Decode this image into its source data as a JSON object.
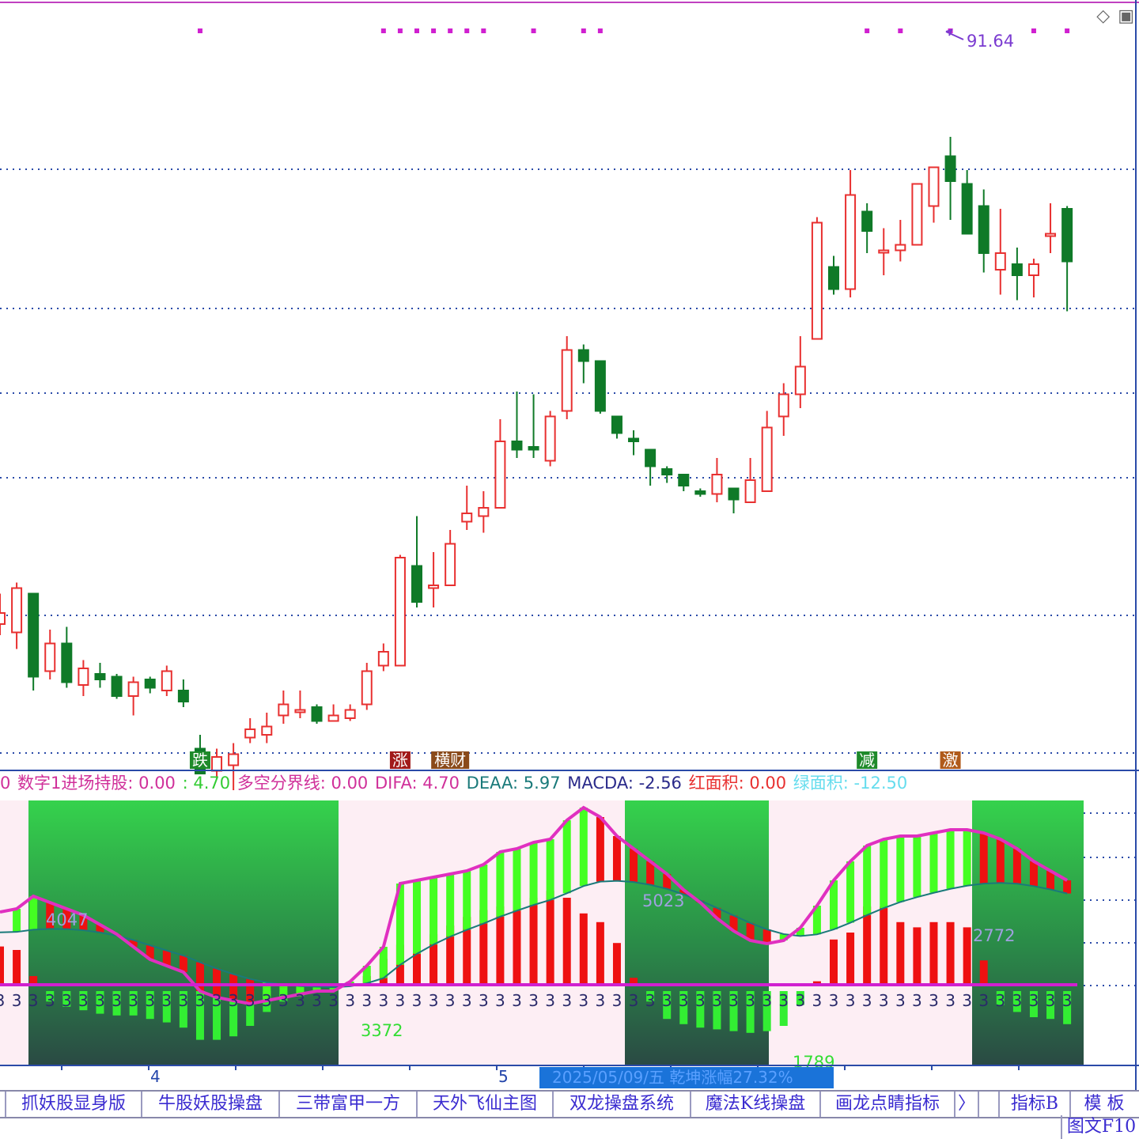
{
  "chart_data": {
    "type": "candlestick",
    "peak_label": "91.64",
    "candles": [
      {
        "o": 76.9,
        "c": 77.3,
        "h": 78.0,
        "l": 76.5
      },
      {
        "o": 76.6,
        "c": 78.2,
        "h": 78.4,
        "l": 76.0
      },
      {
        "o": 78.0,
        "c": 75.0,
        "h": 78.0,
        "l": 74.5
      },
      {
        "o": 75.2,
        "c": 76.2,
        "h": 76.7,
        "l": 74.9
      },
      {
        "o": 76.2,
        "c": 74.8,
        "h": 76.8,
        "l": 74.6
      },
      {
        "o": 74.7,
        "c": 75.3,
        "h": 75.6,
        "l": 74.3
      },
      {
        "o": 75.1,
        "c": 74.9,
        "h": 75.5,
        "l": 74.6
      },
      {
        "o": 75.0,
        "c": 74.3,
        "h": 75.1,
        "l": 74.2
      },
      {
        "o": 74.3,
        "c": 74.8,
        "h": 75.0,
        "l": 73.6
      },
      {
        "o": 74.9,
        "c": 74.6,
        "h": 75.0,
        "l": 74.4
      },
      {
        "o": 74.5,
        "c": 75.2,
        "h": 75.4,
        "l": 74.3
      },
      {
        "o": 74.5,
        "c": 74.1,
        "h": 74.9,
        "l": 73.9
      },
      {
        "o": 72.4,
        "c": 71.5,
        "h": 72.9,
        "l": 71.5
      },
      {
        "o": 71.6,
        "c": 72.1,
        "h": 72.4,
        "l": 71.3
      },
      {
        "o": 71.8,
        "c": 72.2,
        "h": 72.6,
        "l": 70.9
      },
      {
        "o": 72.8,
        "c": 73.1,
        "h": 73.5,
        "l": 72.6
      },
      {
        "o": 72.9,
        "c": 73.2,
        "h": 73.7,
        "l": 72.6
      },
      {
        "o": 73.6,
        "c": 74.0,
        "h": 74.5,
        "l": 73.3
      },
      {
        "o": 73.8,
        "c": 73.8,
        "h": 74.5,
        "l": 73.5
      },
      {
        "o": 73.9,
        "c": 73.4,
        "h": 74.0,
        "l": 73.3
      },
      {
        "o": 73.4,
        "c": 73.6,
        "h": 74.0,
        "l": 73.4
      },
      {
        "o": 73.5,
        "c": 73.8,
        "h": 74.0,
        "l": 73.4
      },
      {
        "o": 74.0,
        "c": 75.2,
        "h": 75.5,
        "l": 73.8
      },
      {
        "o": 75.4,
        "c": 75.9,
        "h": 76.2,
        "l": 75.2
      },
      {
        "o": 75.4,
        "c": 79.3,
        "h": 79.4,
        "l": 75.4
      },
      {
        "o": 79.0,
        "c": 77.7,
        "h": 80.8,
        "l": 77.5
      },
      {
        "o": 78.2,
        "c": 78.3,
        "h": 79.5,
        "l": 77.5
      },
      {
        "o": 78.3,
        "c": 79.8,
        "h": 80.3,
        "l": 78.3
      },
      {
        "o": 80.6,
        "c": 80.9,
        "h": 81.9,
        "l": 80.3
      },
      {
        "o": 80.8,
        "c": 81.1,
        "h": 81.7,
        "l": 80.2
      },
      {
        "o": 81.1,
        "c": 83.5,
        "h": 84.3,
        "l": 81.1
      },
      {
        "o": 83.5,
        "c": 83.2,
        "h": 85.3,
        "l": 82.9
      },
      {
        "o": 83.3,
        "c": 83.2,
        "h": 85.2,
        "l": 82.9
      },
      {
        "o": 82.8,
        "c": 84.4,
        "h": 84.6,
        "l": 82.6
      },
      {
        "o": 84.6,
        "c": 86.8,
        "h": 87.3,
        "l": 84.3
      },
      {
        "o": 86.8,
        "c": 86.4,
        "h": 87.0,
        "l": 85.6
      },
      {
        "o": 86.4,
        "c": 84.6,
        "h": 86.4,
        "l": 84.5
      },
      {
        "o": 84.4,
        "c": 83.8,
        "h": 84.4,
        "l": 83.6
      },
      {
        "o": 83.6,
        "c": 83.5,
        "h": 83.9,
        "l": 83.0
      },
      {
        "o": 83.2,
        "c": 82.6,
        "h": 83.2,
        "l": 81.9
      },
      {
        "o": 82.5,
        "c": 82.3,
        "h": 82.6,
        "l": 82.0
      },
      {
        "o": 82.3,
        "c": 81.9,
        "h": 82.3,
        "l": 81.7
      },
      {
        "o": 81.7,
        "c": 81.6,
        "h": 81.8,
        "l": 81.5
      },
      {
        "o": 81.6,
        "c": 82.3,
        "h": 82.9,
        "l": 81.3
      },
      {
        "o": 81.8,
        "c": 81.4,
        "h": 81.8,
        "l": 80.9
      },
      {
        "o": 81.3,
        "c": 82.1,
        "h": 82.9,
        "l": 81.3
      },
      {
        "o": 81.7,
        "c": 84.0,
        "h": 84.6,
        "l": 81.7
      },
      {
        "o": 84.4,
        "c": 85.2,
        "h": 85.6,
        "l": 83.7
      },
      {
        "o": 85.2,
        "c": 86.2,
        "h": 87.3,
        "l": 84.7
      },
      {
        "o": 87.2,
        "c": 91.4,
        "h": 91.6,
        "l": 87.2
      },
      {
        "o": 89.8,
        "c": 89.0,
        "h": 90.2,
        "l": 88.8
      },
      {
        "o": 89.0,
        "c": 92.4,
        "h": 93.3,
        "l": 88.7
      },
      {
        "o": 91.8,
        "c": 91.1,
        "h": 92.1,
        "l": 90.3
      },
      {
        "o": 90.4,
        "c": 90.4,
        "h": 91.2,
        "l": 89.5
      },
      {
        "o": 90.4,
        "c": 90.6,
        "h": 91.5,
        "l": 90.0
      },
      {
        "o": 90.6,
        "c": 92.8,
        "h": 92.8,
        "l": 90.6
      },
      {
        "o": 92.0,
        "c": 93.4,
        "h": 93.4,
        "l": 91.4
      },
      {
        "o": 93.8,
        "c": 92.9,
        "h": 94.5,
        "l": 91.5
      },
      {
        "o": 92.8,
        "c": 91.0,
        "h": 93.3,
        "l": 91.0
      },
      {
        "o": 92.0,
        "c": 90.3,
        "h": 92.6,
        "l": 89.6
      },
      {
        "o": 89.7,
        "c": 90.3,
        "h": 91.9,
        "l": 88.8
      },
      {
        "o": 89.9,
        "c": 89.5,
        "h": 90.5,
        "l": 88.6
      },
      {
        "o": 89.5,
        "c": 89.9,
        "h": 90.1,
        "l": 88.7
      },
      {
        "o": 91.0,
        "c": 91.0,
        "h": 92.1,
        "l": 90.3
      },
      {
        "o": 91.9,
        "c": 90.0,
        "h": 92.0,
        "l": 88.2
      }
    ],
    "signal_markers": [
      {
        "index": 12,
        "label": "跌",
        "bg": "#1e8a2a"
      },
      {
        "index": 24,
        "label": "涨",
        "bg": "#a11a1a"
      },
      {
        "index": 27,
        "label": "横财",
        "bg": "#8a4a1a"
      },
      {
        "index": 52,
        "label": "减",
        "bg": "#1e8a2a"
      },
      {
        "index": 57,
        "label": "激",
        "bg": "#b05a1a"
      }
    ],
    "macd_values": [
      2.3,
      2.4,
      2.8,
      2.6,
      2.4,
      2.2,
      1.9,
      1.6,
      1.2,
      0.8,
      0.6,
      0.4,
      -0.2,
      -0.4,
      -0.5,
      -0.6,
      -0.5,
      -0.4,
      -0.3,
      -0.2,
      -0.2,
      0.1,
      0.6,
      1.2,
      3.2,
      3.3,
      3.4,
      3.5,
      3.6,
      3.8,
      4.2,
      4.3,
      4.5,
      4.6,
      5.2,
      5.6,
      5.3,
      4.7,
      4.3,
      3.9,
      3.5,
      3.0,
      2.6,
      2.1,
      1.7,
      1.4,
      1.3,
      1.4,
      1.8,
      2.5,
      3.3,
      3.9,
      4.4,
      4.6,
      4.7,
      4.7,
      4.8,
      4.9,
      4.9,
      4.8,
      4.6,
      4.3,
      3.9,
      3.6,
      3.3
    ],
    "histogram": [
      2.2,
      2.0,
      0.5,
      -0.6,
      -0.9,
      -1.1,
      -1.3,
      -1.4,
      -1.4,
      -1.6,
      -1.8,
      -2.1,
      -2.8,
      -2.8,
      -2.6,
      -2.0,
      -1.2,
      -0.6,
      -0.3,
      0,
      0,
      0,
      0.5,
      1.5,
      2.3,
      2.5,
      2.9,
      3.4,
      3.9,
      4.3,
      4.5,
      4.8,
      5.0,
      5.4,
      5.0,
      4.1,
      3.6,
      2.4,
      0.4,
      -0.6,
      -1.6,
      -1.9,
      -2.1,
      -2.2,
      -2.3,
      -2.4,
      -2.3,
      -2.0,
      -0.8,
      0.2,
      2.6,
      3.0,
      4.5,
      4.5,
      3.6,
      3.3,
      3.6,
      3.6,
      3.3,
      1.4,
      -0.8,
      -1.2,
      -1.5,
      -1.6,
      -1.9
    ],
    "value_labels": [
      "4047",
      "3372",
      "5023",
      "1789",
      "2772"
    ],
    "axis_months": [
      "4",
      "5"
    ]
  },
  "indicator": {
    "items": [
      {
        "text": "0",
        "color": "#d0309a"
      },
      {
        "text": "数字1进场持股: 0.00",
        "color": "#d0309a"
      },
      {
        "text": ": 4.70",
        "color": "#33cc33"
      },
      {
        "text": "多空分界线: 0.00",
        "color": "#d0309a"
      },
      {
        "text": "DIFA: 4.70",
        "color": "#d0309a"
      },
      {
        "text": "DEAA: 5.97",
        "color": "#1a7a7a"
      },
      {
        "text": "MACDA: -2.56",
        "color": "#2a2a8a"
      },
      {
        "text": "红面积: 0.00",
        "color": "#e83030"
      },
      {
        "text": "绿面积: -12.50",
        "color": "#66ddee"
      }
    ]
  },
  "status": {
    "date_text": "2025/05/09/五    乾坤涨幅27.32%"
  },
  "tabs": [
    {
      "label": "抓妖股显身版"
    },
    {
      "label": "牛股妖股操盘"
    },
    {
      "label": "三带富甲一方"
    },
    {
      "label": "天外飞仙主图"
    },
    {
      "label": "双龙操盘系统"
    },
    {
      "label": "魔法K线操盘"
    },
    {
      "label": "画龙点睛指标"
    },
    {
      "label": "〉"
    },
    {
      "label": "指标B"
    },
    {
      "label": "模 板"
    }
  ],
  "f10_label": "图文F10",
  "colors": {
    "up": "#e83030",
    "down": "#0f7a28",
    "grid": "#2a4aa8",
    "magenta": "#d020d0",
    "zone_green": "#2ed04a",
    "zone_pink": "#fdeef4"
  }
}
